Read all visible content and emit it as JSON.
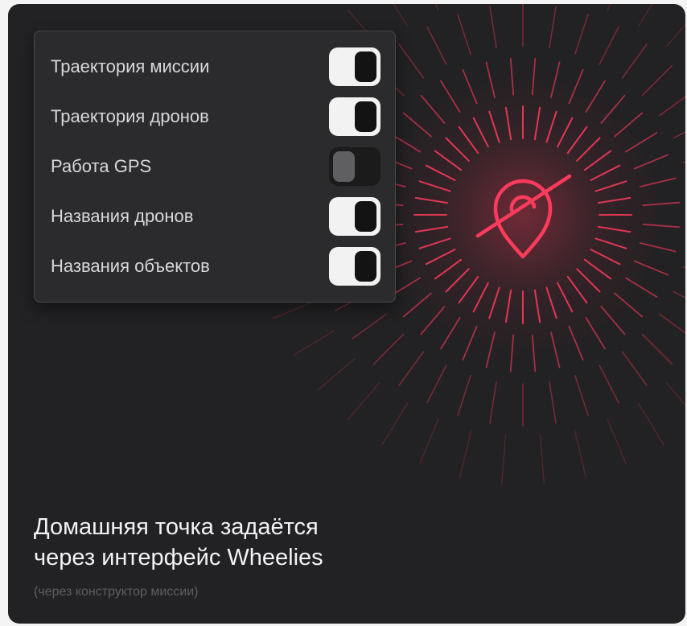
{
  "settings_panel": {
    "items": [
      {
        "label": "Траектория миссии",
        "enabled": true
      },
      {
        "label": "Траектория дронов",
        "enabled": true
      },
      {
        "label": "Работа GPS",
        "enabled": false
      },
      {
        "label": "Названия дронов",
        "enabled": true
      },
      {
        "label": "Названия объектов",
        "enabled": true
      }
    ]
  },
  "promo": {
    "headline_line1": "Домашняя точка задаётся",
    "headline_line2": "через интерфейс Wheelies",
    "note": "(через конструктор миссии)"
  },
  "icons": {
    "center_icon": "location-off-icon"
  },
  "colors": {
    "background": "#222123",
    "accent": "#ff3b5c",
    "panel": "#2b2a2c"
  }
}
